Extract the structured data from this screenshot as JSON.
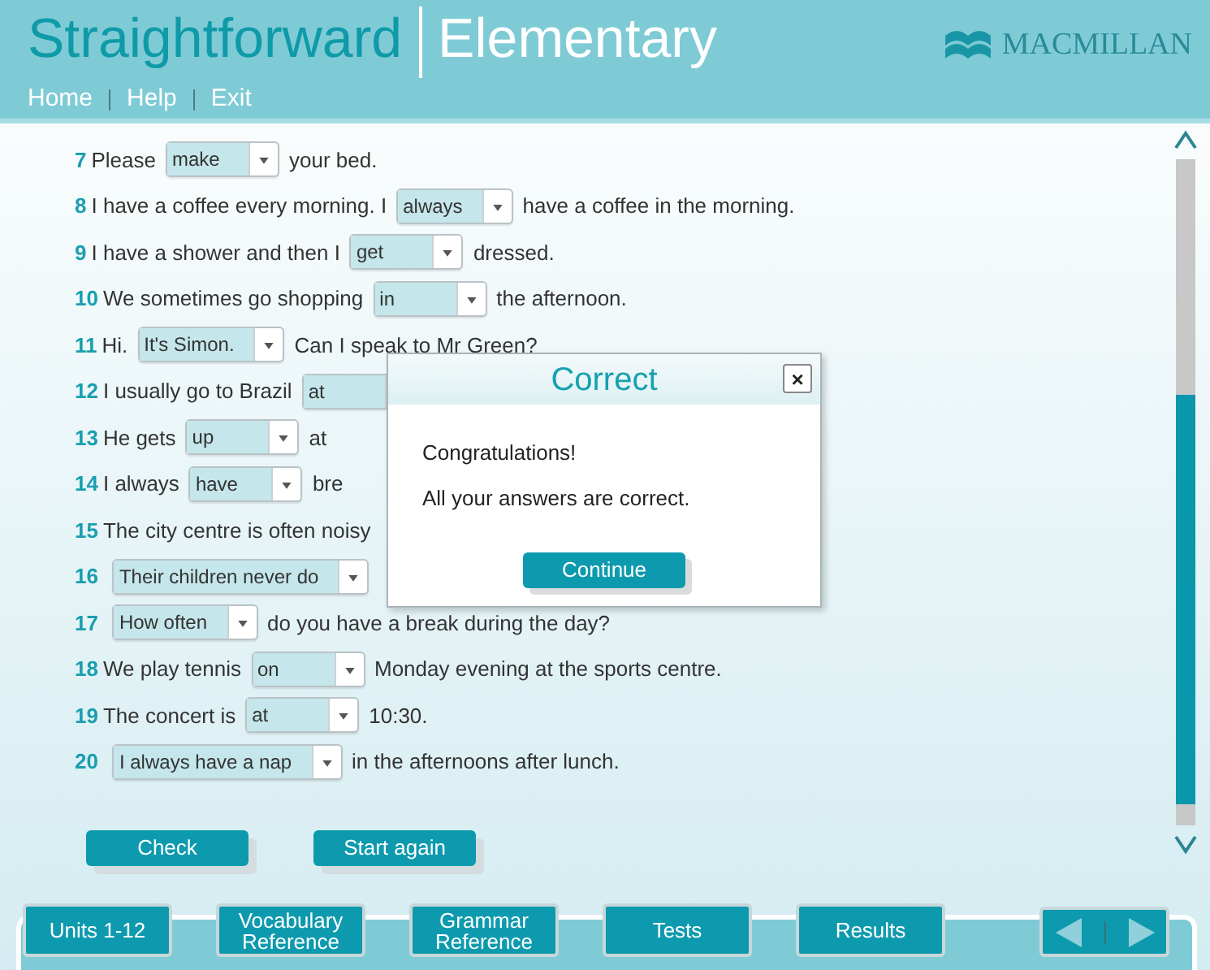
{
  "header": {
    "title": "Straightforward",
    "subtitle": "Elementary",
    "publisher": "MACMILLAN",
    "nav": [
      "Home",
      "Help",
      "Exit"
    ]
  },
  "items": [
    {
      "number": "7",
      "parts": [
        {
          "kind": "text",
          "text": "Please"
        },
        {
          "kind": "select",
          "value": "make"
        },
        {
          "kind": "text",
          "text": "your bed."
        }
      ]
    },
    {
      "number": "8",
      "parts": [
        {
          "kind": "text",
          "text": "I have a coffee every morning. I"
        },
        {
          "kind": "select",
          "value": "always"
        },
        {
          "kind": "text",
          "text": "have a coffee in the morning."
        }
      ]
    },
    {
      "number": "9",
      "parts": [
        {
          "kind": "text",
          "text": "I have a shower and then I"
        },
        {
          "kind": "select",
          "value": "get"
        },
        {
          "kind": "text",
          "text": "dressed."
        }
      ]
    },
    {
      "number": "10",
      "parts": [
        {
          "kind": "text",
          "text": "We sometimes go shopping"
        },
        {
          "kind": "select",
          "value": "in"
        },
        {
          "kind": "text",
          "text": "the afternoon."
        }
      ]
    },
    {
      "number": "11",
      "parts": [
        {
          "kind": "text",
          "text": "Hi."
        },
        {
          "kind": "select",
          "value": "It's Simon."
        },
        {
          "kind": "text",
          "text": "Can I speak to Mr Green?"
        }
      ]
    },
    {
      "number": "12",
      "parts": [
        {
          "kind": "text",
          "text": "I usually go to Brazil"
        },
        {
          "kind": "select",
          "value": "at"
        }
      ]
    },
    {
      "number": "13",
      "parts": [
        {
          "kind": "text",
          "text": "He gets"
        },
        {
          "kind": "select",
          "value": "up"
        },
        {
          "kind": "text",
          "text": "at"
        }
      ]
    },
    {
      "number": "14",
      "parts": [
        {
          "kind": "text",
          "text": "I always"
        },
        {
          "kind": "select",
          "value": "have"
        },
        {
          "kind": "text",
          "text": "bre"
        }
      ]
    },
    {
      "number": "15",
      "parts": [
        {
          "kind": "text",
          "text": "The city centre is often noisy"
        }
      ]
    },
    {
      "number": "16",
      "parts": [
        {
          "kind": "select",
          "value": "Their children never do"
        }
      ]
    },
    {
      "number": "17",
      "parts": [
        {
          "kind": "select",
          "value": "How often"
        },
        {
          "kind": "text",
          "text": "do you have a break during the day?"
        }
      ]
    },
    {
      "number": "18",
      "parts": [
        {
          "kind": "text",
          "text": "We play tennis"
        },
        {
          "kind": "select",
          "value": "on"
        },
        {
          "kind": "text",
          "text": "Monday evening at the sports centre."
        }
      ]
    },
    {
      "number": "19",
      "parts": [
        {
          "kind": "text",
          "text": "The concert is"
        },
        {
          "kind": "select",
          "value": "at"
        },
        {
          "kind": "text",
          "text": "10:30."
        }
      ]
    },
    {
      "number": "20",
      "parts": [
        {
          "kind": "select",
          "value": "I always have a nap"
        },
        {
          "kind": "text",
          "text": "in the afternoons after lunch."
        }
      ]
    }
  ],
  "actions": [
    "Check",
    "Start again"
  ],
  "dialog": {
    "title": "Correct",
    "close": "×",
    "lines": [
      "Congratulations!",
      "All your answers are correct."
    ],
    "button": "Continue"
  },
  "tabs": [
    "Units 1-12",
    "Vocabulary Reference",
    "Grammar Reference",
    "Tests",
    "Results"
  ]
}
